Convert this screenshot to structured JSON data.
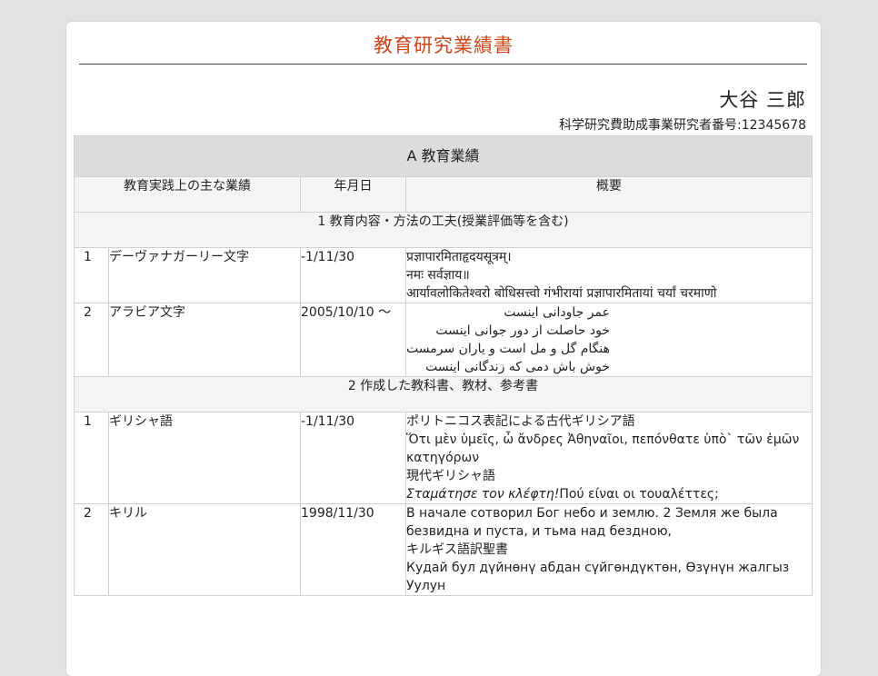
{
  "document": {
    "title": "教育研究業績書",
    "author": "大谷 三郎",
    "researcher_id": "科学研究費助成事業研究者番号:12345678"
  },
  "section_a": {
    "title": "A 教育業績",
    "columns": [
      "教育実践上の主な業績",
      "年月日",
      "概要"
    ]
  },
  "subsections": [
    {
      "title": "1 教育内容・方法の工夫(授業評価等を含む)",
      "rows": [
        {
          "num": "1",
          "name": "デーヴァナガーリー文字",
          "date": "-1/11/30",
          "summary": [
            "प्रज्ञापारमिताहृदयसूत्रम्।",
            "नमः सर्वज्ञाय॥",
            "आर्यावलोकितेश्वरो बोधिसत्त्वो गंभीरायां प्रज्ञापारमितायां चर्यां चरमाणो"
          ]
        },
        {
          "num": "2",
          "name": "アラビア文字",
          "date": "2005/10/10 ～",
          "summary": [
            "عمر جاودانی اینست",
            "خود حاصلت از دور جوانی اینست",
            "هنگام گل و مل است و یاران سرمست",
            "خوش باش دمی که زندگانی اینست"
          ]
        }
      ]
    },
    {
      "title": "2 作成した教科書、教材、参考書",
      "rows": [
        {
          "num": "1",
          "name": "ギリシャ語",
          "date": "-1/11/30",
          "summary": [
            "ポリトニコス表記による古代ギリシア語",
            "Ὅτι μὲν ὑμεῖς, ὦ ἄνδρες Ἀθηναῖοι, πεπόνθατε ὑπὸ` τῶν ἐμῶν κατηγόρων",
            "現代ギリシャ語",
            "Σταμάτησε τον κλέφτη!",
            "Πού είναι οι τουαλέττες;"
          ]
        },
        {
          "num": "2",
          "name": "キリル",
          "date": "1998/11/30",
          "summary": [
            "В начале сотворил Бог небо и землю. 2 Земля же была безвидна и пуста, и тьма над бездною,",
            "キルギス語訳聖書",
            "Кудай бул дүйнөнү абдан сүйгөндүктөн, Өзүнүн жалгыз Уулун"
          ]
        }
      ]
    }
  ]
}
